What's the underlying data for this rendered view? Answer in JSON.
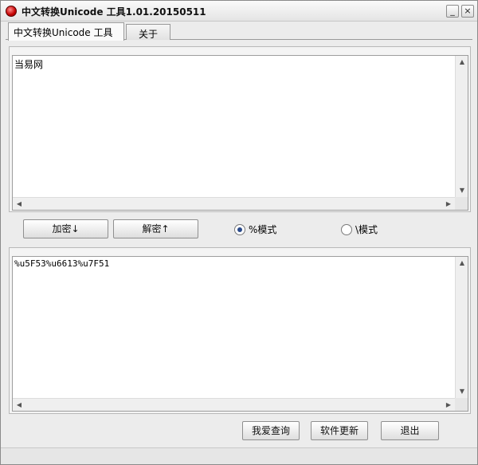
{
  "window": {
    "title": "中文转换Unicode 工具1.01.20150511",
    "minimize_glyph": "_",
    "close_glyph": "×",
    "app_icon": "red-orb-icon"
  },
  "tabs": [
    {
      "label": "中文转换Unicode 工具",
      "active": true
    },
    {
      "label": "关于",
      "active": false
    }
  ],
  "input_area": {
    "value": "当易网"
  },
  "output_area": {
    "value": "%u5F53%u6613%u7F51"
  },
  "actions": {
    "encrypt_label": "加密↓",
    "decrypt_label": "解密↑"
  },
  "modes": {
    "percent_label": "%模式",
    "backslash_label": "\\模式",
    "selected": "percent"
  },
  "footer": {
    "query_label": "我爱查询",
    "update_label": "软件更新",
    "exit_label": "退出"
  },
  "scroll_glyphs": {
    "up": "▲",
    "down": "▼",
    "left": "◀",
    "right": "▶"
  }
}
